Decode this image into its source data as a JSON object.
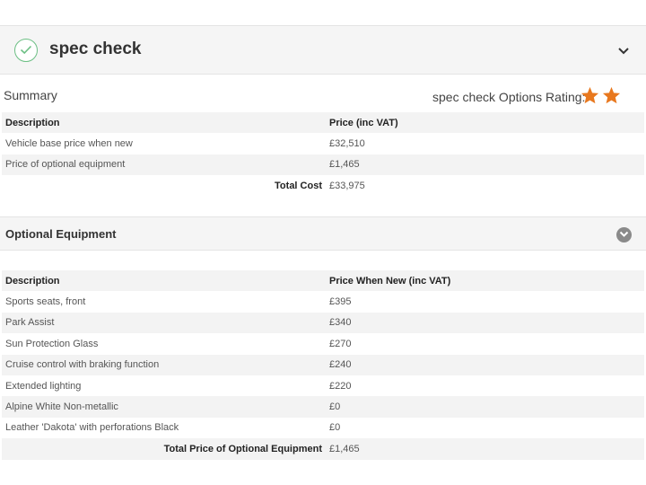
{
  "header": {
    "title": "spec check",
    "check_icon": "check-circle-icon",
    "chevron_icon": "chevron-down-icon",
    "accent_color": "#6cbf84"
  },
  "summary": {
    "label": "Summary",
    "rating_label": "spec check Options Rating:",
    "rating_stars": 2,
    "star_color": "#e8781e",
    "columns": [
      "Description",
      "Price (inc VAT)"
    ],
    "rows": [
      {
        "description": "Vehicle base price when new",
        "price": "£32,510"
      },
      {
        "description": "Price of optional equipment",
        "price": "£1,465"
      }
    ],
    "total_label": "Total Cost",
    "total_value": "£33,975"
  },
  "optional_equipment": {
    "title": "Optional Equipment",
    "toggle_icon": "chevron-down-circle-icon",
    "columns": [
      "Description",
      "Price When New (inc VAT)"
    ],
    "rows": [
      {
        "description": "Sports seats, front",
        "price": "£395"
      },
      {
        "description": "Park Assist",
        "price": "£340"
      },
      {
        "description": "Sun Protection Glass",
        "price": "£270"
      },
      {
        "description": "Cruise control with braking function",
        "price": "£240"
      },
      {
        "description": "Extended lighting",
        "price": "£220"
      },
      {
        "description": "Alpine White Non-metallic",
        "price": "£0"
      },
      {
        "description": "Leather 'Dakota' with perforations Black",
        "price": "£0"
      }
    ],
    "total_label": "Total Price of Optional Equipment",
    "total_value": "£1,465"
  }
}
